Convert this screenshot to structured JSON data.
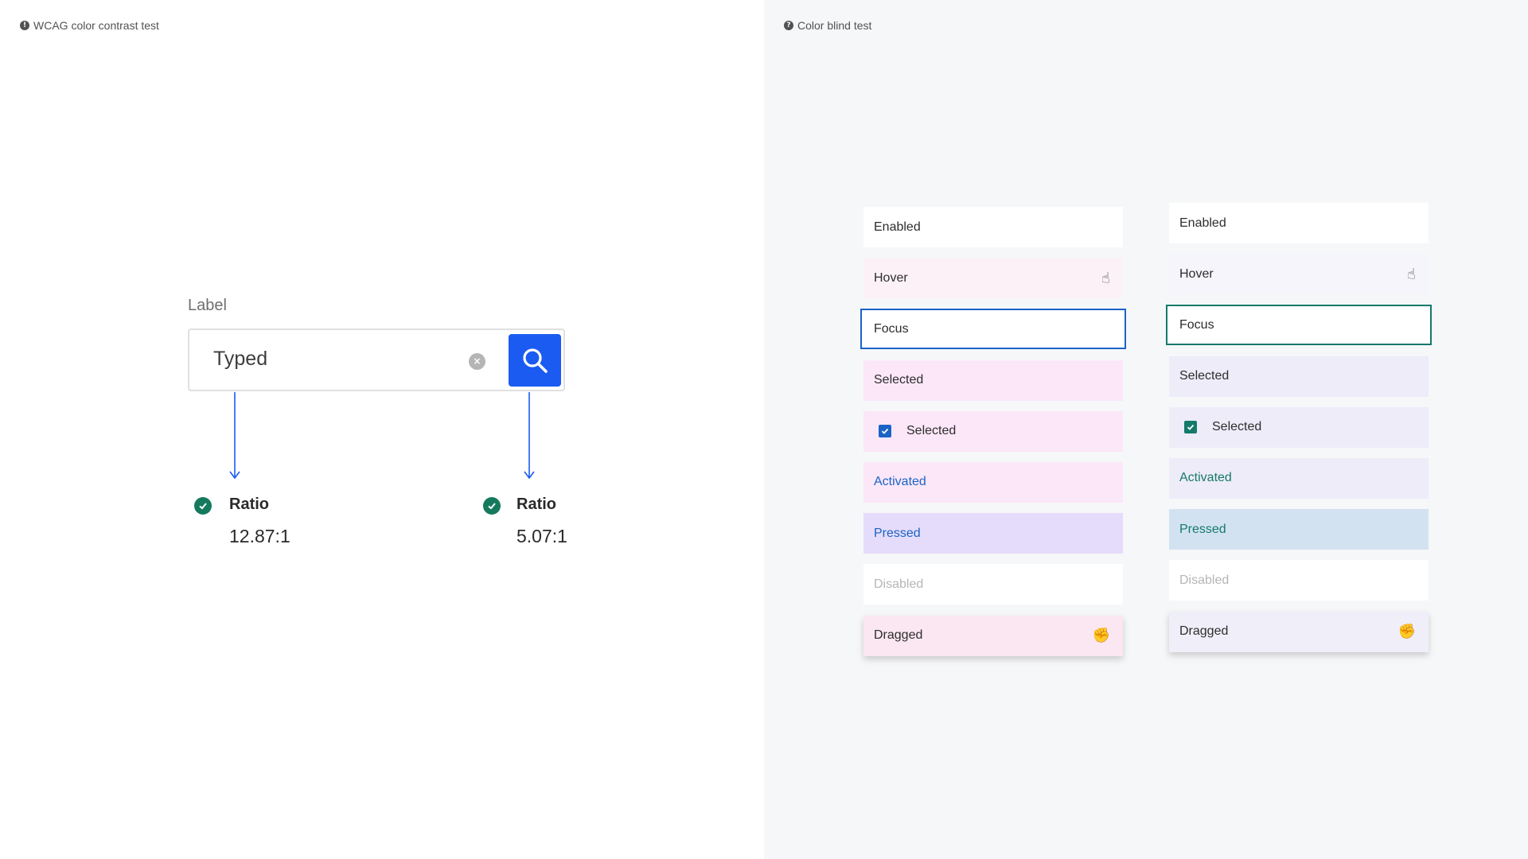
{
  "wcag": {
    "title": "WCAG color contrast test",
    "info_icon": "!",
    "label": "Label",
    "input_value": "Typed",
    "clear_icon": "×",
    "ratios": [
      {
        "label": "Ratio",
        "value": "12.87:1"
      },
      {
        "label": "Ratio",
        "value": "5.07:1"
      }
    ]
  },
  "colorblind": {
    "title": "Color blind test",
    "info_icon": "?",
    "cursor_hover_icon": "☝",
    "cursor_drag_icon": "✊",
    "column_a": {
      "accent": "#1b63c6",
      "states": [
        "Enabled",
        "Hover",
        "Focus",
        "Selected",
        "Selected",
        "Activated",
        "Pressed",
        "Disabled",
        "Dragged"
      ]
    },
    "column_b": {
      "accent": "#147a6a",
      "states": [
        "Enabled",
        "Hover",
        "Focus",
        "Selected",
        "Selected",
        "Activated",
        "Pressed",
        "Disabled",
        "Dragged"
      ]
    }
  },
  "colors": {
    "primary_blue": "#1b5bf1",
    "success_green": "#157a5d",
    "teal": "#147a6a"
  }
}
